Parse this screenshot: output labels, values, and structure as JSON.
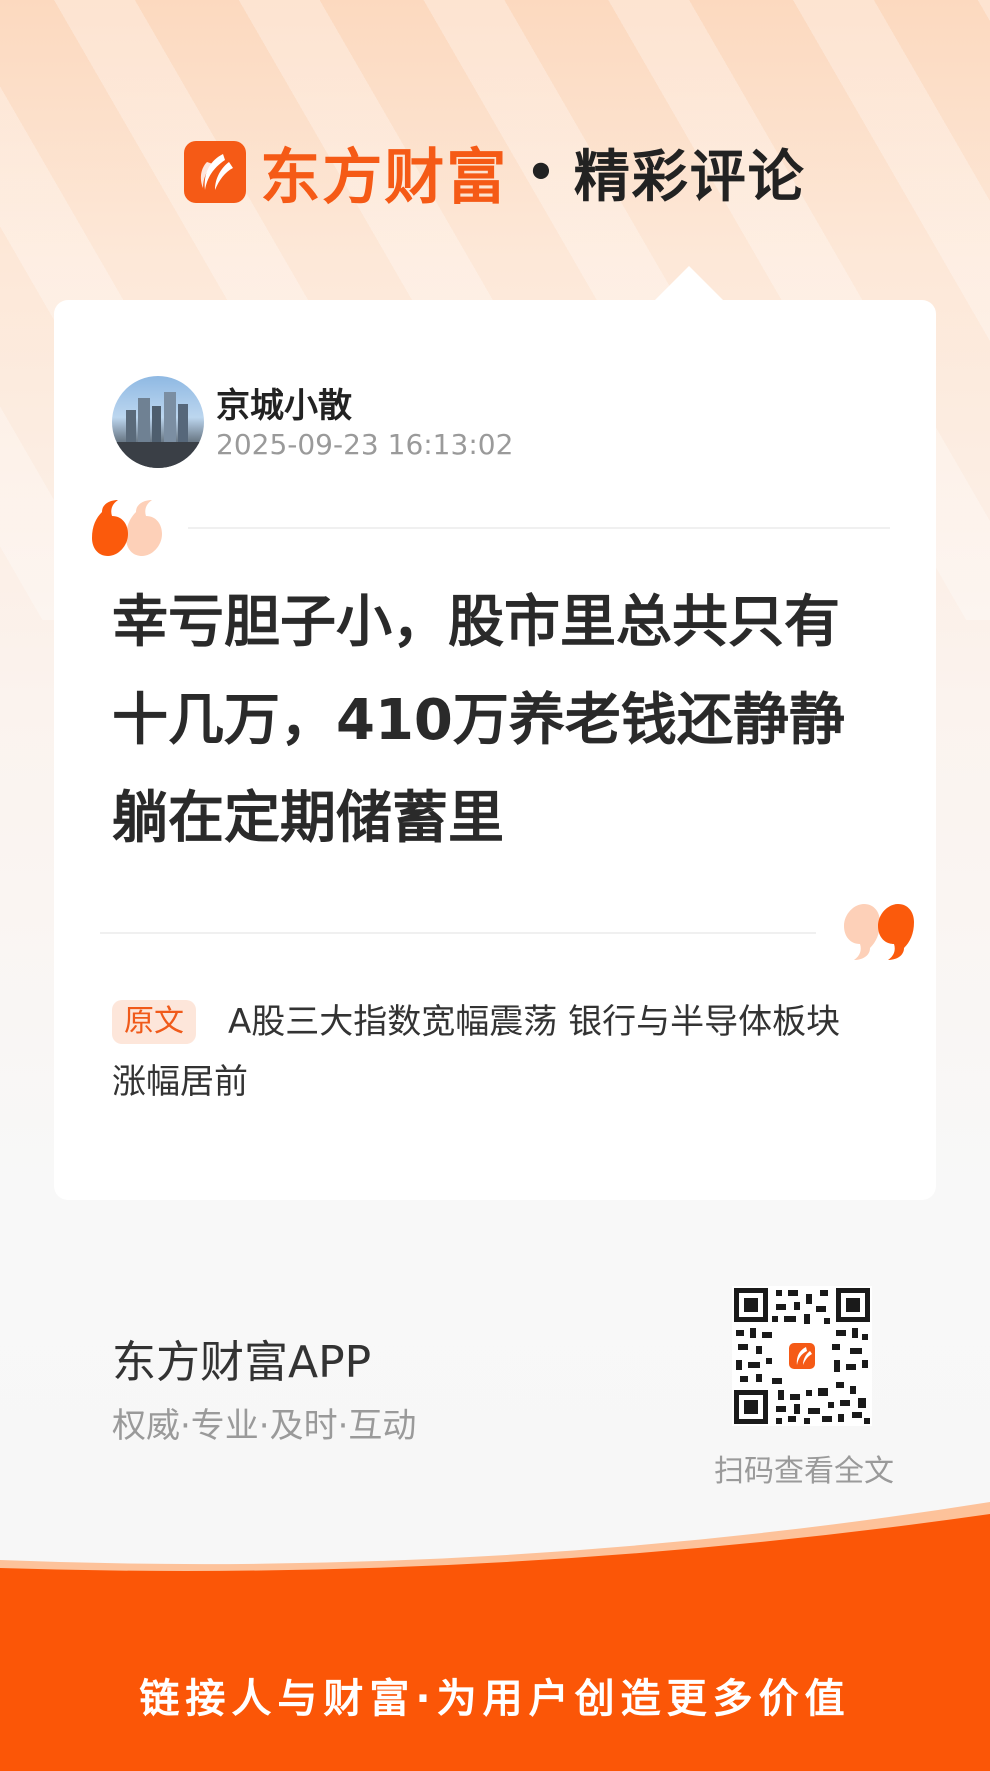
{
  "header": {
    "brand_name": "东方财富",
    "separator": "•",
    "section_title": "精彩评论"
  },
  "post": {
    "username": "京城小散",
    "timestamp": "2025-09-23 16:13:02",
    "comment": "幸亏胆子小，股市里总共只有十几万，410万养老钱还静静躺在定期储蓄里",
    "source_tag": "原文",
    "source_title": "A股三大指数宽幅震荡 银行与半导体板块涨幅居前"
  },
  "promo": {
    "app_name": "东方财富APP",
    "slogan": "权威·专业·及时·互动",
    "qr_caption": "扫码查看全文"
  },
  "footer": {
    "tagline": "链接人与财富·为用户创造更多价值"
  },
  "colors": {
    "brand_orange": "#f55a16",
    "footer_orange": "#fb5607",
    "quote_orange": "#fb5a0c",
    "quote_peach": "#fdd0b8"
  }
}
